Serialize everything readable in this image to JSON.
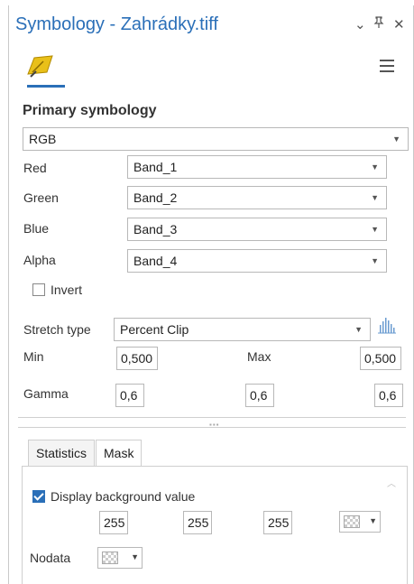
{
  "window": {
    "title": "Symbology - Zahrádky.tiff",
    "controls": {
      "collapse": "⌄",
      "pin": "⁣ꟸ",
      "close": "✕"
    }
  },
  "toolbar": {
    "tab_icon": "raster-symbology-icon",
    "menu_icon": "hamburger-menu-icon"
  },
  "primary": {
    "title": "Primary symbology",
    "renderer": "RGB"
  },
  "bands": [
    {
      "label": "Red",
      "value": "Band_1"
    },
    {
      "label": "Green",
      "value": "Band_2"
    },
    {
      "label": "Blue",
      "value": "Band_3"
    },
    {
      "label": "Alpha",
      "value": "Band_4"
    }
  ],
  "invert": {
    "label": "Invert",
    "checked": false
  },
  "stretch": {
    "label": "Stretch type",
    "value": "Percent Clip",
    "min_label": "Min",
    "min_value": "0,500",
    "max_label": "Max",
    "max_value": "0,500",
    "gamma_label": "Gamma",
    "gamma_values": [
      "0,6",
      "0,6",
      "0,6"
    ]
  },
  "tabs": [
    {
      "label": "Statistics",
      "active": false
    },
    {
      "label": "Mask",
      "active": true
    }
  ],
  "mask": {
    "display_bg_label": "Display background value",
    "display_bg_checked": true,
    "bg_values": [
      "255",
      "255",
      "255"
    ],
    "nodata_label": "Nodata"
  },
  "colors": {
    "accent": "#2a6fb8"
  }
}
